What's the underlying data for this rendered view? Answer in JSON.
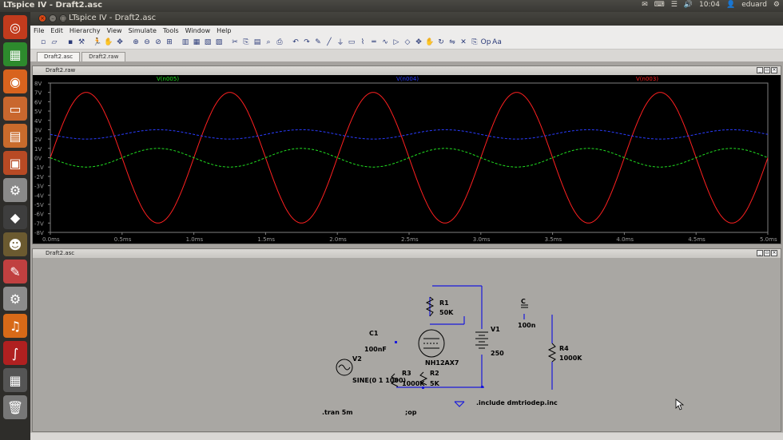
{
  "os_panel": {
    "app_title": "LTspice IV - Draft2.asc",
    "user": "eduard",
    "time": "10:04"
  },
  "window": {
    "title": "LTspice IV - Draft2.asc"
  },
  "menu": [
    "File",
    "Edit",
    "Hierarchy",
    "View",
    "Simulate",
    "Tools",
    "Window",
    "Help"
  ],
  "tabs": [
    "Draft2.asc",
    "Draft2.raw"
  ],
  "waveform_window": {
    "title": "Draft2.raw",
    "traces": [
      {
        "label": "V(n005)",
        "color": "#21e021"
      },
      {
        "label": "V(n004)",
        "color": "#2a3cff"
      },
      {
        "label": "V(n003)",
        "color": "#ff2020"
      }
    ],
    "y_ticks": [
      "8V",
      "7V",
      "6V",
      "5V",
      "4V",
      "3V",
      "2V",
      "1V",
      "0V",
      "-1V",
      "-2V",
      "-3V",
      "-4V",
      "-5V",
      "-6V",
      "-7V",
      "-8V"
    ],
    "x_ticks": [
      "0.0ms",
      "0.5ms",
      "1.0ms",
      "1.5ms",
      "2.0ms",
      "2.5ms",
      "3.0ms",
      "3.5ms",
      "4.0ms",
      "4.5ms",
      "5.0ms"
    ]
  },
  "chart_data": {
    "type": "line",
    "xlim": [
      0,
      5
    ],
    "ylim": [
      -8,
      8
    ],
    "x_unit": "ms",
    "y_unit": "V",
    "frequency_khz": 1,
    "series": [
      {
        "name": "V(n003)",
        "color": "#ff2020",
        "offset": 0,
        "amplitude": 7,
        "phase": "sin"
      },
      {
        "name": "V(n004)",
        "color": "#2a3cff",
        "offset": 2.5,
        "amplitude": 0.5,
        "phase": "-sin"
      },
      {
        "name": "V(n005)",
        "color": "#21e021",
        "offset": 0,
        "amplitude": 1,
        "phase": "-sin"
      }
    ],
    "grid": false
  },
  "schematic_window": {
    "title": "Draft2.asc",
    "labels": {
      "r1": "R1",
      "r1_val": "50K",
      "c1": "C1",
      "c1_val": "100nF",
      "v1": "V1",
      "v1_val": "250",
      "v2": "V2",
      "v2_val": "SINE(0 1 1000)",
      "tube": "NH12AX7",
      "r3": "R3",
      "r3_val": "1000K",
      "r2": "R2",
      "r2_val": "5K",
      "c_top": "C",
      "c_top_val": "100n",
      "r4": "R4",
      "r4_val": "1000K",
      "include": ".include dmtriodep.inc",
      "tran": ".tran 5m",
      "op": ";op"
    }
  }
}
